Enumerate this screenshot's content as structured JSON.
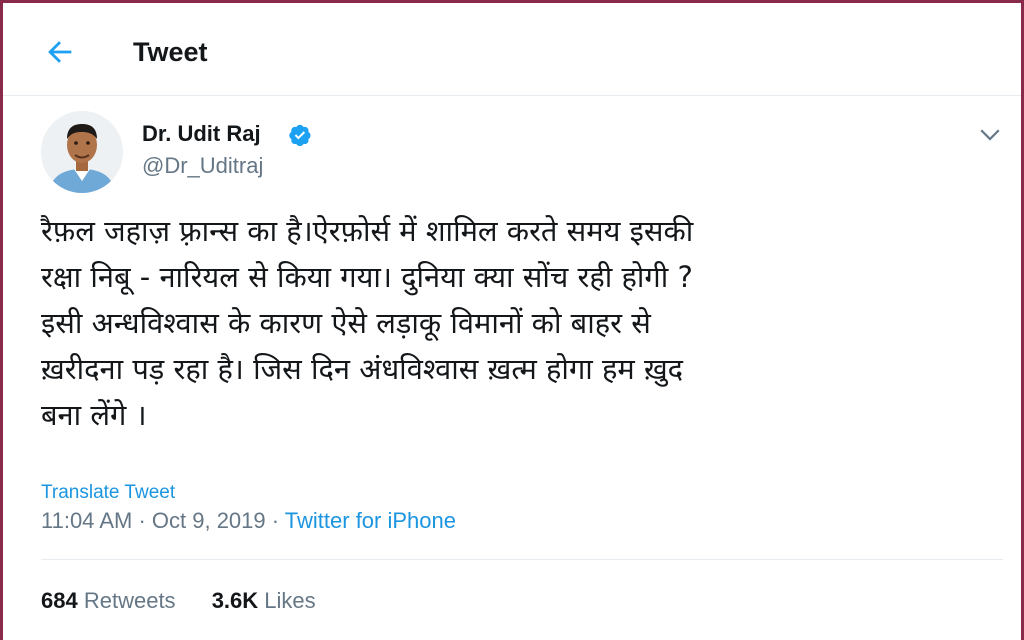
{
  "header": {
    "back_icon": "arrow-left-icon",
    "title": "Tweet"
  },
  "tweet": {
    "author": {
      "name": "Dr. Udit Raj",
      "handle": "@Dr_Uditraj",
      "verified_icon": "verified-badge-icon"
    },
    "menu_icon": "chevron-down-icon",
    "text": "रैफ़ल जहाज़ फ़्रान्स का है।ऐरफ़ोर्स में शामिल करते समय इसकी\nरक्षा निबू - नारियल से किया गया। दुनिया क्या सोंच रही होगी ?\nइसी अन्धविश्वास के कारण ऐसे लड़ाकू विमानों को बाहर से\nख़रीदना पड़ रहा है। जिस दिन अंधविश्वास ख़त्म होगा हम ख़ुद\nबना लेंगे ।",
    "translate_label": "Translate Tweet",
    "time": "11:04 AM",
    "separator": " · ",
    "date": "Oct 9, 2019",
    "source": "Twitter for iPhone",
    "stats": {
      "retweets_count": "684",
      "retweets_label": "Retweets",
      "likes_count": "3.6K",
      "likes_label": "Likes"
    }
  },
  "colors": {
    "accent": "#1da1f2",
    "link": "#1b95e0",
    "muted": "#657786",
    "text": "#14171a",
    "frame": "#8a2a4a"
  }
}
